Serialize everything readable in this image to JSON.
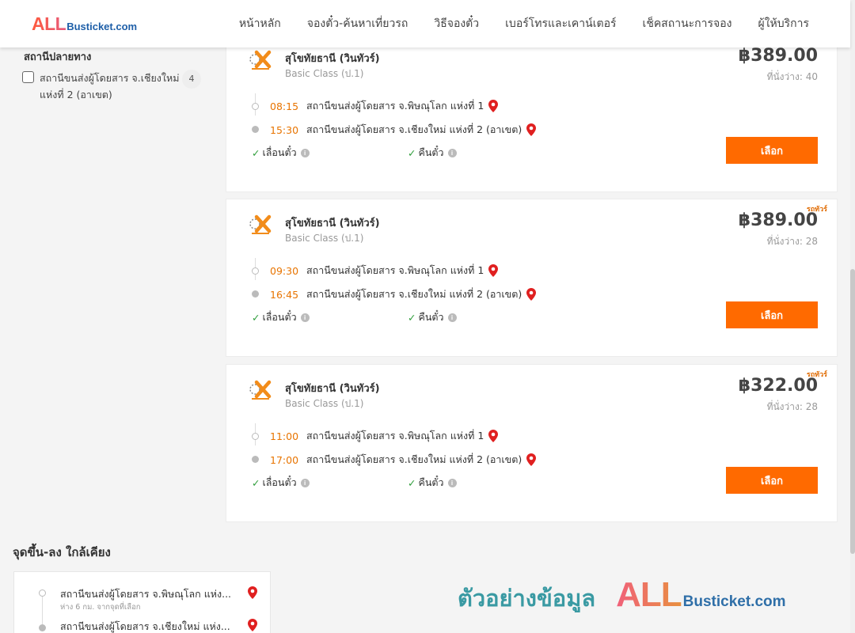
{
  "header": {
    "logo": {
      "part1": "ALL",
      "part2": "Busticket.com"
    },
    "nav": [
      "หน้าหลัก",
      "จองตั๋ว-ค้นหาเที่ยวรถ",
      "วิธีจองตั๋ว",
      "เบอร์โทรและเคาน์เตอร์",
      "เช็คสถานะการจอง",
      "ผู้ให้บริการ"
    ]
  },
  "sidebar": {
    "filter_title": "สถานีปลายทาง",
    "items": [
      {
        "label": "สถานีขนส่งผู้โดยสาร จ.เชียงใหม่ แห่งที่ 2 (อาเขต)",
        "count": "4",
        "checked": false
      }
    ]
  },
  "trips": [
    {
      "badge": "",
      "operator": "สุโขทัยธานี (วินทัวร์)",
      "bus_class": "Basic Class (ป.1)",
      "price": "฿389.00",
      "seats": "ที่นั่งว่าง: 40",
      "depart_time": "08:15",
      "depart_station": "สถานีขนส่งผู้โดยสาร จ.พิษณุโลก แห่งที่ 1",
      "arrive_time": "15:30",
      "arrive_station": "สถานีขนส่งผู้โดยสาร จ.เชียงใหม่ แห่งที่ 2 (อาเขต)",
      "policy_change": "เลื่อนตั๋ว",
      "policy_refund": "คืนตั๋ว",
      "select_label": "เลือก"
    },
    {
      "badge": "รถทัวร์",
      "operator": "สุโขทัยธานี (วินทัวร์)",
      "bus_class": "Basic Class (ป.1)",
      "price": "฿389.00",
      "seats": "ที่นั่งว่าง: 28",
      "depart_time": "09:30",
      "depart_station": "สถานีขนส่งผู้โดยสาร จ.พิษณุโลก แห่งที่ 1",
      "arrive_time": "16:45",
      "arrive_station": "สถานีขนส่งผู้โดยสาร จ.เชียงใหม่ แห่งที่ 2 (อาเขต)",
      "policy_change": "เลื่อนตั๋ว",
      "policy_refund": "คืนตั๋ว",
      "select_label": "เลือก"
    },
    {
      "badge": "รถทัวร์",
      "operator": "สุโขทัยธานี (วินทัวร์)",
      "bus_class": "Basic Class (ป.1)",
      "price": "฿322.00",
      "seats": "ที่นั่งว่าง: 28",
      "depart_time": "11:00",
      "depart_station": "สถานีขนส่งผู้โดยสาร จ.พิษณุโลก แห่งที่ 1",
      "arrive_time": "17:00",
      "arrive_station": "สถานีขนส่งผู้โดยสาร จ.เชียงใหม่ แห่งที่ 2 (อาเขต)",
      "policy_change": "เลื่อนตั๋ว",
      "policy_refund": "คืนตั๋ว",
      "select_label": "เลือก"
    }
  ],
  "nearby": {
    "title": "จุดขึ้น-ลง ใกล้เคียง",
    "from": "สถานีขนส่งผู้โดยสาร จ.พิษณุโลก แห่ง...",
    "from_sub": "ห่าง 6 กม. จากจุดที่เลือก",
    "to": "สถานีขนส่งผู้โดยสาร จ.เชียงใหม่ แห่ง..."
  },
  "watermark": {
    "text": "ตัวอย่างข้อมูล",
    "logo_part1": "ALL",
    "logo_part2": "Busticket.com"
  },
  "colors": {
    "accent": "#ff6a00",
    "time": "#e87400",
    "check": "#2e9d3a",
    "pin": "#e02020"
  }
}
